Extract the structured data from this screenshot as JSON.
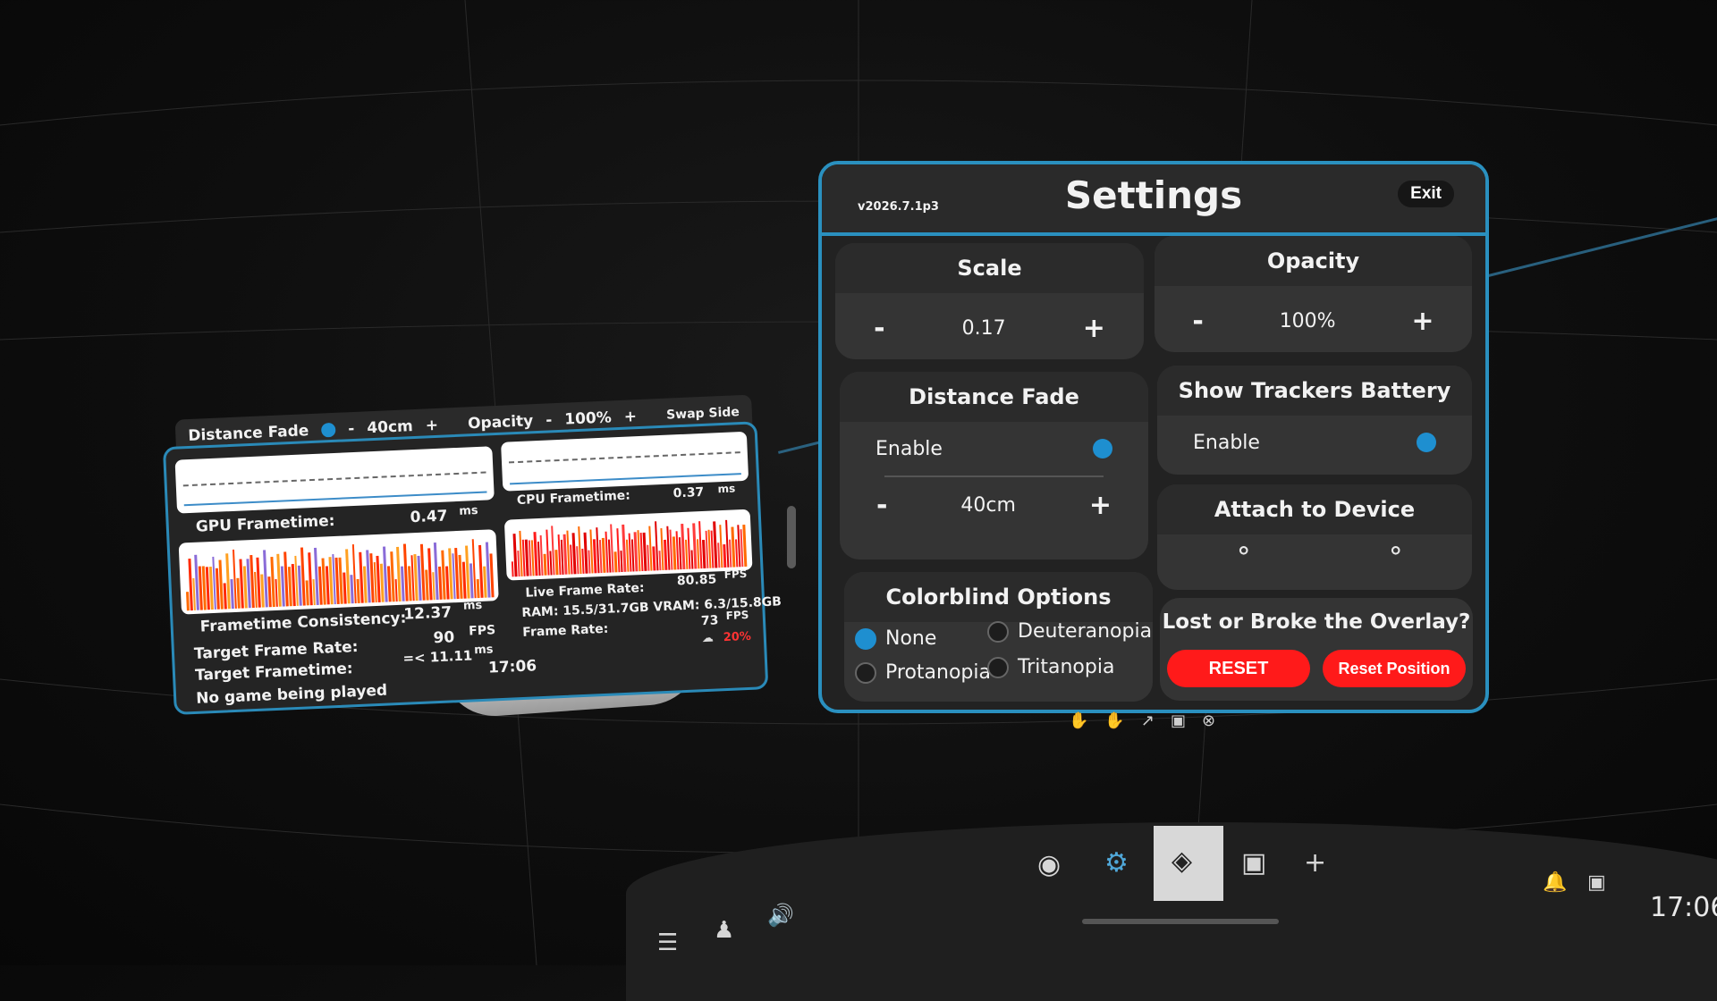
{
  "perf": {
    "header": {
      "distance_fade_label": "Distance Fade",
      "minus": "-",
      "distance_value": "40cm",
      "plus": "+",
      "opacity_label": "Opacity",
      "opacity_value": "100%",
      "swap_side": "Swap Side"
    },
    "gpu_frametime_label": "GPU Frametime:",
    "gpu_frametime_value": "0.47",
    "cpu_frametime_label": "CPU Frametime:",
    "cpu_frametime_value": "0.37",
    "ms": "ms",
    "frametime_consistency_label": "Frametime Consistency:",
    "frametime_consistency_value": "12.37",
    "live_frame_rate_label": "Live Frame Rate:",
    "live_frame_rate_value": "80.85",
    "fps": "FPS",
    "ram_vram": "RAM: 15.5/31.7GB VRAM: 6.3/15.8GB",
    "frame_rate_label": "Frame Rate:",
    "frame_rate_value": "73",
    "target_frame_rate_label": "Target Frame Rate:",
    "target_frame_rate_value": "90",
    "target_frametime_label": "Target Frametime:",
    "target_frametime_value": "=< 11.11",
    "battery_value": "20%",
    "time": "17:06",
    "no_game": "No game being played"
  },
  "settings": {
    "version": "v2026.7.1p3",
    "title": "Settings",
    "exit": "Exit",
    "scale": {
      "title": "Scale",
      "minus": "-",
      "value": "0.17",
      "plus": "+"
    },
    "opacity": {
      "title": "Opacity",
      "minus": "-",
      "value": "100%",
      "plus": "+"
    },
    "distance_fade": {
      "title": "Distance Fade",
      "enable": "Enable",
      "minus": "-",
      "value": "40cm",
      "plus": "+"
    },
    "trackers": {
      "title": "Show Trackers Battery",
      "enable": "Enable"
    },
    "attach": {
      "title": "Attach to Device"
    },
    "colorblind": {
      "title": "Colorblind Options",
      "none": "None",
      "deuteranopia": "Deuteranopia",
      "protanopia": "Protanopia",
      "tritanopia": "Tritanopia"
    },
    "lost": {
      "title": "Lost or Broke the Overlay?",
      "reset": "RESET",
      "reset_position": "Reset Position"
    }
  },
  "taskbar": {
    "clock": "17:06",
    "plus": "+"
  },
  "colors": {
    "accent": "#2a90bf",
    "toggle": "#1e8fd0",
    "danger": "#ff1a1a",
    "battery_low": "#ff3333"
  }
}
